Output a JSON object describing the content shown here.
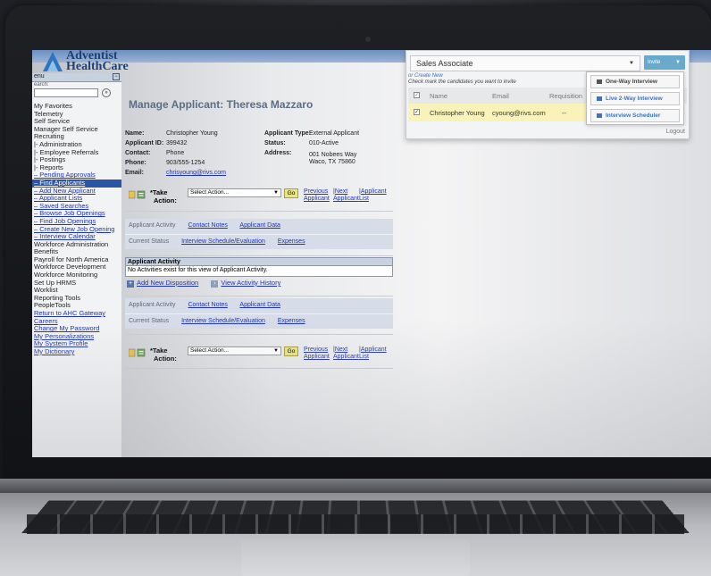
{
  "brand": {
    "line1": "Adventist",
    "line2": "HealthCare"
  },
  "sidebar": {
    "title": "enu",
    "search_label": "earch:",
    "search_value": "",
    "items": [
      {
        "label": "My Favorites",
        "type": "plain"
      },
      {
        "label": "Telemetry",
        "type": "plain"
      },
      {
        "label": "Self Service",
        "type": "plain"
      },
      {
        "label": "Manager Self Service",
        "type": "plain"
      },
      {
        "label": "Recruiting",
        "type": "plain"
      },
      {
        "label": "|- Administration",
        "type": "plain"
      },
      {
        "label": "|- Employee Referrals",
        "type": "plain"
      },
      {
        "label": "|- Postings",
        "type": "plain"
      },
      {
        "label": "|- Reports",
        "type": "plain"
      },
      {
        "label": "– Pending Approvals",
        "type": "link"
      },
      {
        "label": "– Find Applicants",
        "type": "active"
      },
      {
        "label": "– Add New Applicant",
        "type": "link"
      },
      {
        "label": "– Applicant Lists",
        "type": "link"
      },
      {
        "label": "– Saved Searches",
        "type": "link"
      },
      {
        "label": "– Browse Job Openings",
        "type": "link"
      },
      {
        "label": "– Find Job Openings",
        "type": "link"
      },
      {
        "label": "– Create New Job Opening",
        "type": "link"
      },
      {
        "label": "– Interview Calendar",
        "type": "link"
      },
      {
        "label": "Workforce Administration",
        "type": "plain"
      },
      {
        "label": "Benefits",
        "type": "plain"
      },
      {
        "label": "Payroll for North America",
        "type": "plain"
      },
      {
        "label": "Workforce Development",
        "type": "plain"
      },
      {
        "label": "Workforce Monitoring",
        "type": "plain"
      },
      {
        "label": "Set Up HRMS",
        "type": "plain"
      },
      {
        "label": "Worklist",
        "type": "plain"
      },
      {
        "label": "Reporting Tools",
        "type": "plain"
      },
      {
        "label": "PeopleTools",
        "type": "plain"
      },
      {
        "label": "Return to AHC Gateway",
        "type": "link"
      },
      {
        "label": "Careers",
        "type": "link"
      },
      {
        "label": "Change My Password",
        "type": "link"
      },
      {
        "label": "My Personalizations",
        "type": "link"
      },
      {
        "label": "My System Profile",
        "type": "link"
      },
      {
        "label": "My Dictionary",
        "type": "link"
      }
    ]
  },
  "main": {
    "title": "Manage Applicant: Theresa Mazzaro",
    "info": {
      "name_label": "Name:",
      "name": "Christopher Young",
      "id_label": "Applicant ID:",
      "id": "399432",
      "contact_label": "Contact:",
      "contact": "Phone",
      "phone_label": "Phone:",
      "phone": "903/555-1254",
      "email_label": "Email:",
      "email": "chrisyoung@rivs.com",
      "type_label": "Applicant Type:",
      "type": "External Applicant",
      "status_label": "Status:",
      "status": "010-Active",
      "address_label": "Address:",
      "address1": "001 Nobees Way",
      "address2": "Waco, TX 75860"
    },
    "action": {
      "label1": "*Take",
      "label2": "Action:",
      "select_value": "Select Action...",
      "go": "Go",
      "prev1": "Previous",
      "prev2": "Applicant",
      "next1": "Next",
      "next2": "Applicant",
      "list1": "Applicant",
      "list2": "List",
      "sep": "|"
    },
    "tabs": {
      "row1": [
        "Applicant Activity",
        "Contact Notes",
        "Applicant Data"
      ],
      "row2": [
        "Current Status",
        "Interview Schedule/Evaluation",
        "Expenses"
      ]
    },
    "activity": {
      "header": "Applicant Activity",
      "message": "No Activities exist for this view of Applicant Activity.",
      "add_link": "Add New Disposition",
      "view_link": "View Activity History"
    }
  },
  "popup": {
    "selected_job": "Sales Associate",
    "invite_label": "Invite",
    "create_new": "or Create New",
    "hint": "Check mark the candidates you want to invite",
    "columns": [
      "Name",
      "Email",
      "Requisition"
    ],
    "row": {
      "name": "Christopher Young",
      "email": "cyoung@rivs.com",
      "requisition": "--"
    },
    "logout": "Logout",
    "interview_menu": [
      "One-Way Interview",
      "Live 2-Way Interview",
      "Interview Scheduler"
    ]
  }
}
